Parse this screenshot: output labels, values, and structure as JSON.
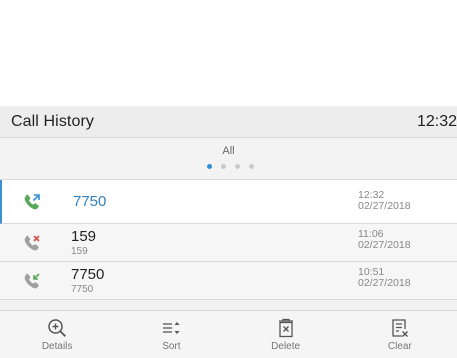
{
  "header": {
    "title": "Call History",
    "clock": "12:32"
  },
  "filter": {
    "label": "All",
    "pages": 4,
    "active_page": 1
  },
  "calls": [
    {
      "type": "outgoing",
      "number": "7750",
      "sub": "",
      "time": "12:32",
      "date": "02/27/2018",
      "selected": true
    },
    {
      "type": "missed",
      "number": "159",
      "sub": "159",
      "time": "11:06",
      "date": "02/27/2018",
      "selected": false
    },
    {
      "type": "received",
      "number": "7750",
      "sub": "7750",
      "time": "10:51",
      "date": "02/27/2018",
      "selected": false
    }
  ],
  "toolbar": {
    "details_label": "Details",
    "sort_label": "Sort",
    "delete_label": "Delete",
    "clear_label": "Clear"
  },
  "colors": {
    "accent": "#2f8fd8",
    "icon_green": "#5aa95a",
    "icon_red": "#d9534f"
  },
  "icons": {
    "details": "zoom-in-icon",
    "sort": "sort-icon",
    "delete": "delete-icon",
    "clear": "clear-list-icon"
  }
}
